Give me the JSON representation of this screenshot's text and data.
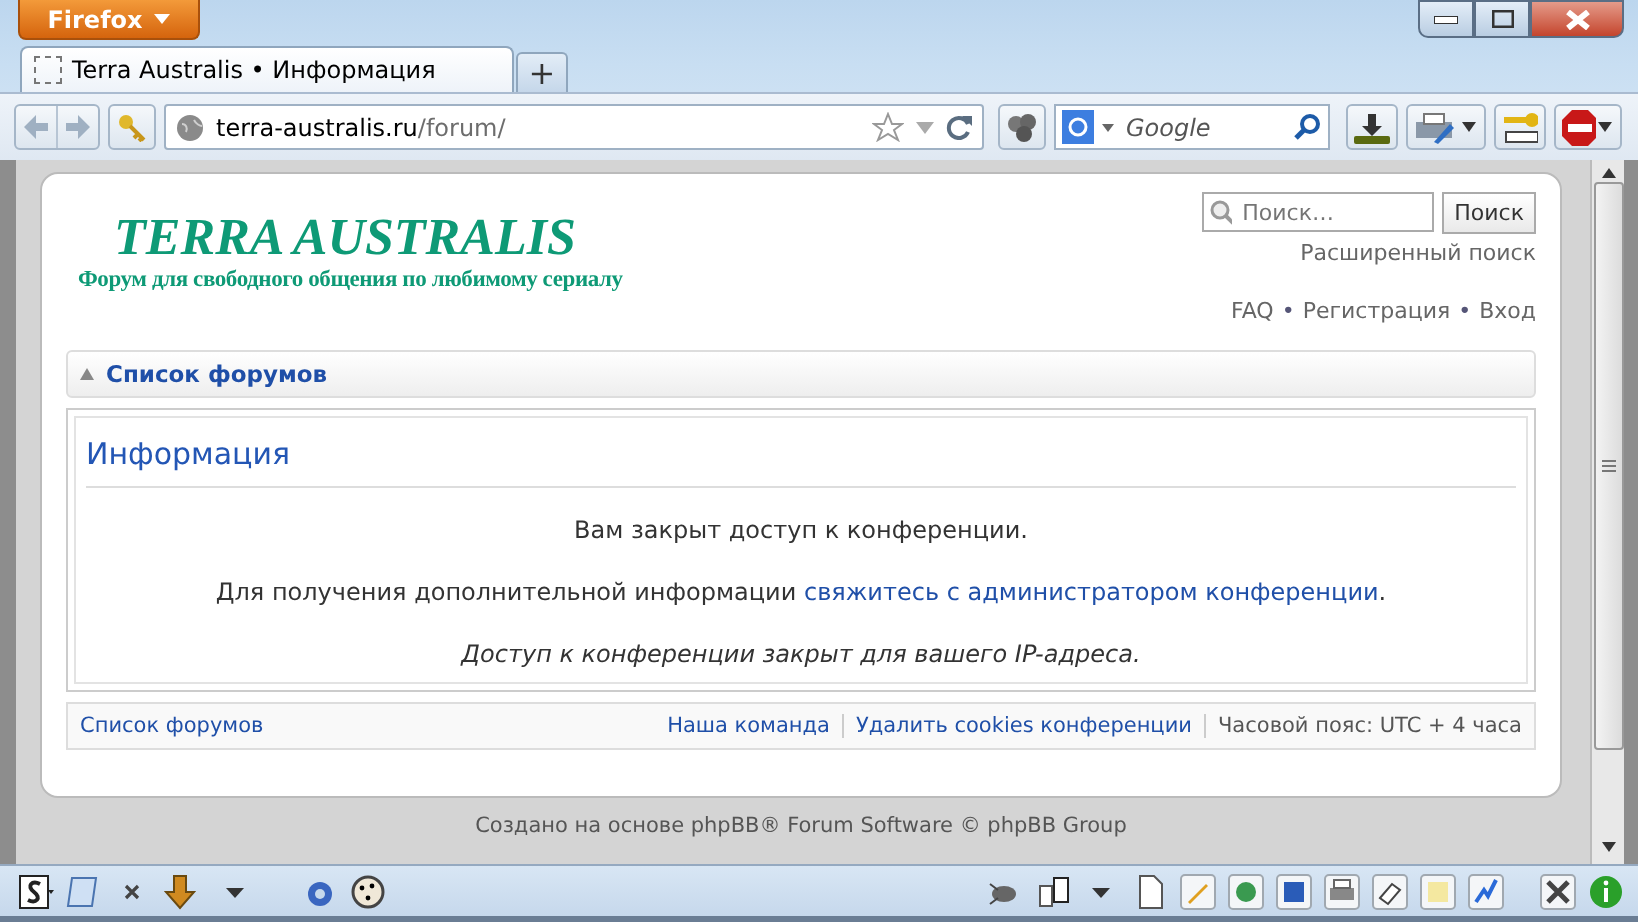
{
  "browser": {
    "app_button": "Firefox",
    "tab": {
      "title": "Terra Australis • Информация",
      "selected": true
    },
    "new_tab": "+",
    "url": {
      "host": "terra-australis.ru",
      "path": "/forum/"
    },
    "search": {
      "placeholder": "Google"
    }
  },
  "header": {
    "logo_title": "TERRA AUSTRALIS",
    "logo_subtitle": "Форум для свободного общения по любимому сериалу",
    "search_placeholder": "Поиск…",
    "search_button": "Поиск",
    "advanced_search": "Расширенный поиск",
    "links": [
      "FAQ",
      "Регистрация",
      "Вход"
    ],
    "separator": "•"
  },
  "breadcrumb": "Список форумов",
  "panel": {
    "title": "Информация",
    "paragraphs": [
      {
        "kind": "plain",
        "text": "Вам закрыт доступ к конференции."
      },
      {
        "kind": "link",
        "before": "Для получения дополнительной информации ",
        "link": "свяжитесь с администратором конференции",
        "after": "."
      },
      {
        "kind": "italic",
        "text": "Доступ к конференции закрыт для вашего IP-адреса."
      }
    ]
  },
  "footer_nav": {
    "home": "Список форумов",
    "links": [
      "Наша команда",
      "Удалить cookies конференции"
    ],
    "timezone": "Часовой пояс: UTC + 4 часа"
  },
  "copyright": "Создано на основе phpBB® Forum Software © phpBB Group"
}
